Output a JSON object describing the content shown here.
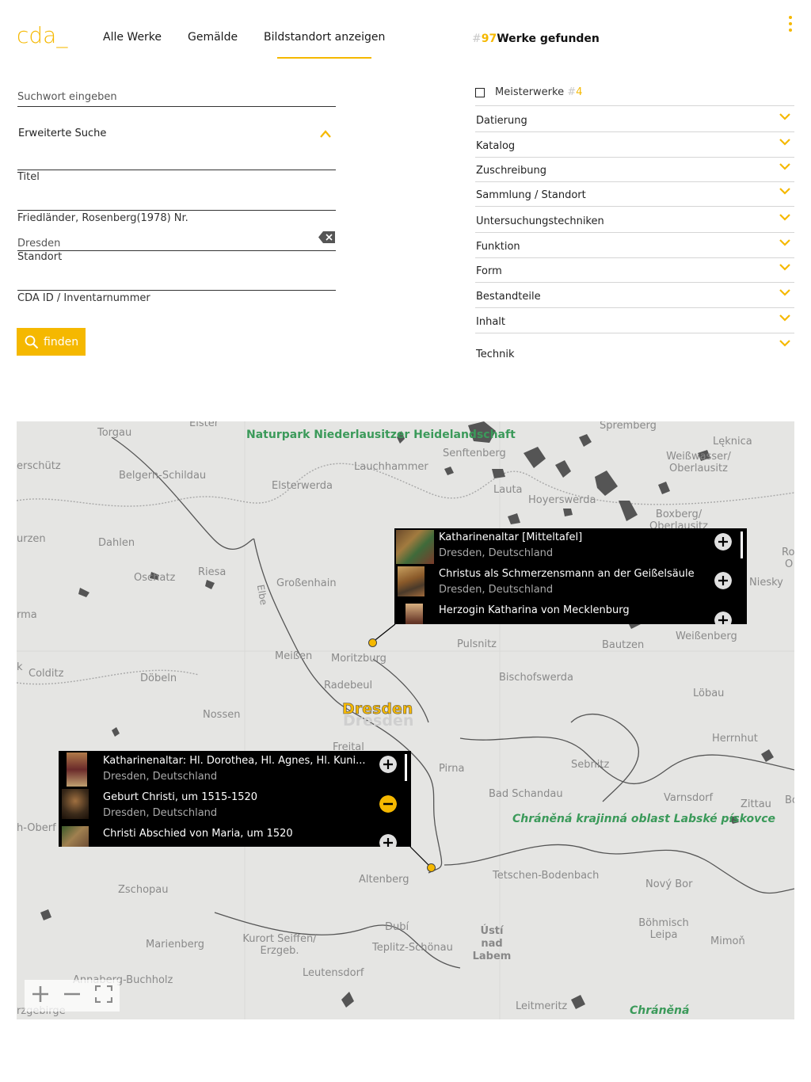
{
  "header": {
    "logo": "cda_",
    "nav": [
      "Alle Werke",
      "Gemälde",
      "Bildstandort anzeigen"
    ],
    "results_hash": "#",
    "results_count": "97",
    "results_label": "Werke gefunden"
  },
  "search": {
    "keyword_placeholder": "Suchwort eingeben",
    "advanced_label": "Erweiterte Suche",
    "title_label": "Titel",
    "fr_label": "Friedländer, Rosenberg(1978) Nr.",
    "location_value": "Dresden",
    "location_label": "Standort",
    "cda_label": "CDA ID / Inventarnummer",
    "find_label": "finden"
  },
  "filters": {
    "masterworks_label": "Meisterwerke",
    "masterworks_hash": "#",
    "masterworks_count": "4",
    "items": [
      "Datierung",
      "Katalog",
      "Zuschreibung",
      "Sammlung / Standort",
      "Untersuchungstechniken",
      "Funktion",
      "Form",
      "Bestandteile",
      "Inhalt",
      "Technik"
    ]
  },
  "map": {
    "city": "Dresden",
    "places": [
      "Torgau",
      "Elster",
      "Spremberg",
      "Lęknica",
      "erschütz",
      "Belgern-Schildau",
      "Elsterwerda",
      "Lauchhammer",
      "Senftenberg",
      "Weißwasser/ Oberlausitz",
      "Lauta",
      "Hoyerswerda",
      "Boxberg/ Oberlausitz",
      "urzen",
      "Dahlen",
      "Oschatz",
      "Riesa",
      "Großenhain",
      "Elbe",
      "Niesky",
      "Ro",
      "O",
      "rma",
      "Meißen",
      "Moritzburg",
      "Pulsnitz",
      "Bautzen",
      "Weißenberg",
      "Colditz",
      "Döbeln",
      "Radebeul",
      "Bischofswerda",
      "Löbau",
      "Nossen",
      "Freital",
      "Pirna",
      "Sebnitz",
      "Herrnhut",
      "Bad Schandau",
      "Varnsdorf",
      "Zittau",
      "Bo",
      "h-Oberf",
      "Zschopau",
      "Altenberg",
      "Tetschen-Bodenbach",
      "Nový Bor",
      "Dubí",
      "Ústí nad Labem",
      "Teplitz-Schönau",
      "Böhmisch Leipa",
      "Mimoň",
      "Marienberg",
      "Kurort Seiffen/ Erzgeb.",
      "Leutensdorf",
      "Annaberg-Buchholz",
      "Leitmeritz",
      "k",
      "rzgebirge"
    ],
    "parks": [
      "Naturpark Niederlausitzer Heidelandschaft",
      "Chráněná krajinná oblast Labské pískovce",
      "Chráněná"
    ],
    "popup_top": [
      {
        "title": "Katharinenaltar [Mitteltafel]",
        "sub": "Dresden, Deutschland",
        "btn": "plus"
      },
      {
        "title": "Christus als Schmerzensmann an der Geißelsäule",
        "sub": "Dresden, Deutschland",
        "btn": "plus"
      },
      {
        "title": "Herzogin Katharina von Mecklenburg",
        "sub": "",
        "btn": "plus"
      }
    ],
    "popup_bottom": [
      {
        "title": "Katharinenaltar: Hl. Dorothea, Hl. Agnes, Hl. Kuni...",
        "sub": "Dresden, Deutschland",
        "btn": "plus"
      },
      {
        "title": "Geburt Christi, um 1515-1520",
        "sub": "Dresden, Deutschland",
        "btn": "minus"
      },
      {
        "title": "Christi Abschied von Maria, um 1520",
        "sub": "",
        "btn": "plus"
      }
    ],
    "controls": [
      "zoom-in-icon",
      "zoom-out-icon",
      "fullscreen-icon"
    ]
  },
  "colors": {
    "accent": "#f5b800",
    "map_bg": "#e5e5e3",
    "popup_bg": "#000000"
  }
}
